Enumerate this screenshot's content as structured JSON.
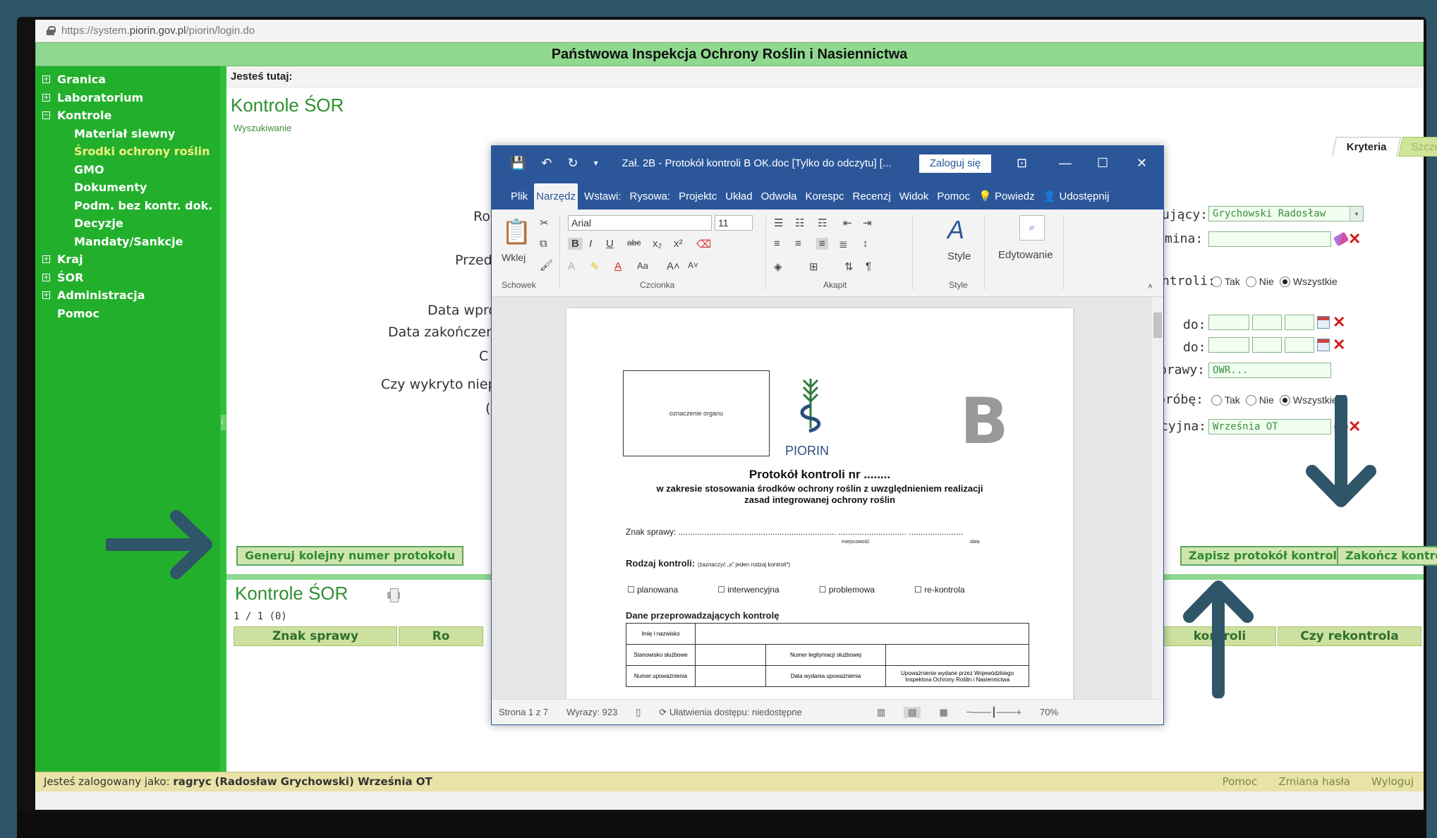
{
  "browser": {
    "url_prefix": "https://system.",
    "url_domain": "piorin.gov.pl",
    "url_path": "/piorin/login.do"
  },
  "site": {
    "title": "Państwowa Inspekcja Ochrony Roślin i Nasiennictwa"
  },
  "sidebar": {
    "items": [
      {
        "label": "Granica",
        "box": "+"
      },
      {
        "label": "Laboratorium",
        "box": "+"
      },
      {
        "label": "Kontrole",
        "box": "−"
      },
      {
        "label": "Materiał siewny"
      },
      {
        "label": "Środki ochrony roślin"
      },
      {
        "label": "GMO"
      },
      {
        "label": "Dokumenty"
      },
      {
        "label": "Podm. bez kontr. dok."
      },
      {
        "label": "Decyzje"
      },
      {
        "label": "Mandaty/Sankcje"
      },
      {
        "label": "Kraj",
        "box": "+"
      },
      {
        "label": "ŚOR",
        "box": "+"
      },
      {
        "label": "Administracja",
        "box": "+"
      },
      {
        "label": "Pomoc"
      }
    ]
  },
  "main": {
    "breadcrumb": "Jesteś tutaj:",
    "title": "Kontrole ŚOR",
    "search_link": "Wyszukiwanie",
    "tabs": [
      "Kryteria",
      "Szczegóły"
    ],
    "left_labels": [
      "Ro",
      "Przed",
      "Data wpro",
      "Data zakończeni",
      "C",
      "Czy wykryto niep",
      "("
    ],
    "right_labels": {
      "inspector": "ujący:",
      "gmina": "mina:",
      "kontroli": "ntroli:",
      "do1": "do:",
      "do2": "do:",
      "sprawy": "prawy:",
      "probe": "próbę:",
      "cyjna": "cyjna:"
    },
    "inspector_value": "Grychowski Radosław",
    "sprawy_value": "OWR...",
    "cyjna_value": "Września OT",
    "radio_options": [
      "Tak",
      "Nie",
      "Wszystkie"
    ],
    "buttons": {
      "generate": "Generuj kolejny numer protokołu",
      "save": "Zapisz protokół kontroli",
      "finish": "Zakończ kontrolę"
    },
    "list_title": "Kontrole ŚOR",
    "pager": "1 / 1 (0)",
    "columns": [
      "Znak sprawy",
      "Ro",
      "kontroli",
      "Czy rekontrola"
    ]
  },
  "status": {
    "prefix": "Jesteś zalogowany jako: ",
    "user": "ragryc",
    "name": "(Radosław Grychowski)",
    "unit": " Września OT",
    "links": [
      "Pomoc",
      "Zmiana hasła",
      "Wyloguj"
    ]
  },
  "word": {
    "doc_title": "Zał. 2B - Protokół kontroli B OK.doc [Tylko do odczytu] [...",
    "login": "Zaloguj się",
    "tabs": [
      "Plik",
      "Narzędz",
      "Wstawi:",
      "Rysowa:",
      "Projektc",
      "Układ",
      "Odwoła",
      "Korespc",
      "Recenzj",
      "Widok",
      "Pomoc",
      "Powiedz",
      "Udostępnij"
    ],
    "ribbon": {
      "paste": "Wklej",
      "font": "Arial",
      "size": "11",
      "style": "Style",
      "edit": "Edytowanie",
      "groups": [
        "Schowek",
        "Czcionka",
        "Akapit",
        "Style"
      ]
    },
    "doc": {
      "organ": "oznaczenie organu",
      "piorin": "PIORIN",
      "big_letter": "B",
      "heading": "Protokół kontroli nr ........",
      "sub1": "w zakresie stosowania środków ochrony roślin z uwzględnieniem realizacji",
      "sub2": "zasad integrowanej ochrony roślin",
      "znak": "Znak sprawy: ...................................................................  .............................  .......................",
      "miejsc": "miejscowość",
      "data": "data",
      "rodzaj": "Rodzaj kontroli:",
      "rodzaj_note": "(zaznaczyć „x” jeden rodzaj kontroli*)",
      "checks": [
        "planowana",
        "interwencyjna",
        "problemowa",
        "re-kontrola"
      ],
      "dane": "Dane przeprowadzających kontrolę",
      "table": {
        "r1": "Imię i nazwisko",
        "r2": "Stanowisko służbowe",
        "r2b": "Numer legitymacji służbowej",
        "r3": "Numer upoważnienia",
        "r3b": "Data wydania upoważnienia",
        "r3c": "Upoważnienie wydane przez Wojewódzkiego Inspektora Ochrony Roślin i Nasiennictwa"
      }
    },
    "status": {
      "page": "Strona 1 z 7",
      "words": "Wyrazy: 923",
      "access": "Ułatwienia dostępu: niedostępne",
      "zoom": "70%"
    }
  },
  "colors": {
    "sidebar": "#22b02c",
    "word_blue": "#2b579a",
    "arrow": "#2f5568"
  }
}
